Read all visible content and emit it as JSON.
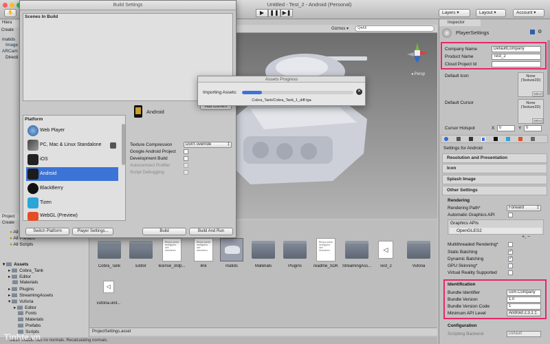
{
  "window_title": "Untitled - Test_2 - Android (Personal)",
  "toolbar": {
    "create_label": "Create",
    "gizmos_label": "Gizmos",
    "search_label": "Q▾All",
    "layers_label": "Layers",
    "layout_label": "Layout",
    "account_label": "Account"
  },
  "hierarchy": {
    "tab_label": "Hiera",
    "items": [
      "matids",
      "Image",
      "ARCam",
      "Directi"
    ]
  },
  "build_settings": {
    "title": "Build Settings",
    "scenes_header": "Scenes In Build",
    "add_current_label": "Add Current",
    "platform_header": "Platform",
    "platforms": [
      "Web Player",
      "PC, Mac & Linux Standalone",
      "iOS",
      "Android",
      "BlackBerry",
      "Tizen",
      "WebGL (Preview)"
    ],
    "selected_platform": "Android",
    "texture_compression_label": "Texture Compression",
    "texture_compression_value": "Don't override",
    "options": [
      {
        "label": "Google Android Project",
        "checked": false,
        "disabled": false
      },
      {
        "label": "Development Build",
        "checked": false,
        "disabled": false
      },
      {
        "label": "Autoconnect Profiler",
        "checked": false,
        "disabled": true
      },
      {
        "label": "Script Debugging",
        "checked": false,
        "disabled": true
      }
    ],
    "switch_platform_label": "Switch Platform",
    "player_settings_label": "Player Settings...",
    "build_label": "Build",
    "build_and_run_label": "Build And Run"
  },
  "progress": {
    "title": "Assets Progress",
    "label": "Importing Assets:",
    "file": "Cobra_Tank/Cobra_Tank_1_diff.tga",
    "fraction": 0.18
  },
  "scene_view": {
    "persp_label": "◂ Persp",
    "axis_labels": [
      "y",
      "x",
      "z"
    ]
  },
  "project": {
    "tab_label": "Project",
    "create_label": "Create",
    "favorites": [
      "All Models",
      "All Prefabs",
      "All Scripts"
    ],
    "tree": [
      "Assets",
      "Cobra_Tank",
      "Editor",
      "Materials",
      "Plugins",
      "StreamingAssets",
      "Vuforia",
      "Editor",
      "Fonts",
      "Materials",
      "Prefabs",
      "Scripts"
    ],
    "breadcrumb": "ProjectSettings.asset",
    "assets_row1": [
      "Cobra_Tank",
      "Editor",
      "license_3rdp...",
      "link",
      "matids",
      "Materials",
      "Plugins",
      "readme_SDK",
      "StreamingAss...",
      "Test_2",
      "Vuforia"
    ],
    "assets_row2": [
      "vuforia-unit..."
    ],
    "doc_snippet": "Bimpa panta sechgrpno sint doluntrem."
  },
  "status_bar": "Mesh 'matids' has no normals. Recalculating normals.",
  "watermark": "Tinhte.vn",
  "inspector": {
    "tab_label": "Inspector",
    "object_name": "PlayerSettings",
    "company_name_label": "Company Name",
    "company_name_value": "DefaultCompany",
    "product_name_label": "Product Name",
    "product_name_value": "Test_2",
    "cloud_project_label": "Cloud Project Id",
    "cloud_project_value": "",
    "default_icon_label": "Default Icon",
    "default_cursor_label": "Default Cursor",
    "none_texture": "None (Texture2D)",
    "select_label": "Select",
    "cursor_hotspot_label": "Cursor Hotspot",
    "hotspot_x": "0",
    "hotspot_y": "0",
    "settings_for": "Settings for Android",
    "sections": [
      "Resolution and Presentation",
      "Icon",
      "Splash Image",
      "Other Settings"
    ],
    "rendering_header": "Rendering",
    "rendering_path_label": "Rendering Path*",
    "rendering_path_value": "Forward",
    "auto_graphics_label": "Automatic Graphics API",
    "graphics_apis_label": "Graphics APIs",
    "graphics_api_item": "OpenGLES2",
    "render_options": [
      {
        "label": "Multithreaded Rendering*",
        "checked": false
      },
      {
        "label": "Static Batching",
        "checked": true
      },
      {
        "label": "Dynamic Batching",
        "checked": true
      },
      {
        "label": "GPU Skinning*",
        "checked": false
      },
      {
        "label": "Virtual Reality Supported",
        "checked": false
      }
    ],
    "identification_header": "Identification",
    "bundle_identifier_label": "Bundle Identifier",
    "bundle_identifier_value": "com.Company",
    "bundle_version_label": "Bundle Version",
    "bundle_version_value": "1.0",
    "bundle_version_code_label": "Bundle Version Code",
    "bundle_version_code_value": "1",
    "min_api_label": "Minimum API Level",
    "min_api_value": "Android 2.3.1 ‡",
    "configuration_header": "Configuration",
    "scripting_backend_label": "Scripting Backend",
    "scripting_backend_value": "Default"
  },
  "colors": {
    "highlight_box": "#e8256a",
    "selection": "#3b73d6"
  }
}
